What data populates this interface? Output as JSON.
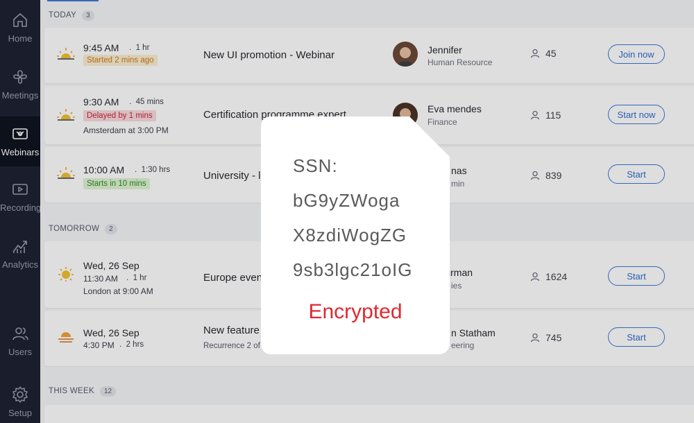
{
  "sidebar": {
    "items": [
      {
        "label": "Home",
        "icon": "home-icon",
        "active": false
      },
      {
        "label": "Meetings",
        "icon": "meetings-icon",
        "active": false
      },
      {
        "label": "Webinars",
        "icon": "webinars-icon",
        "active": true
      },
      {
        "label": "Recordings",
        "icon": "recordings-icon",
        "active": false
      },
      {
        "label": "Analytics",
        "icon": "analytics-icon",
        "active": false
      },
      {
        "label": "Users",
        "icon": "users-icon",
        "active": false
      },
      {
        "label": "Setup",
        "icon": "setup-icon",
        "active": false
      }
    ]
  },
  "sections": [
    {
      "title": "TODAY",
      "count": "3"
    },
    {
      "title": "TOMORROW",
      "count": "2"
    },
    {
      "title": "THIS WEEK",
      "count": "12"
    }
  ],
  "webinars": [
    {
      "time": "9:45 AM",
      "duration": "1 hr",
      "badge": "Started 2 mins ago",
      "badge_type": "orange",
      "title": "New UI promotion - Webinar",
      "host": "Jennifer",
      "dept": "Human Resource",
      "attendees": "45",
      "action": "Join now"
    },
    {
      "time": "9:30 AM",
      "duration": "45 mins",
      "badge": "Delayed by 1 mins",
      "badge_type": "red",
      "extra": "Amsterdam at 3:00 PM",
      "title": "Certification programme expert",
      "host": "Eva mendes",
      "dept": "Finance",
      "attendees": "115",
      "action": "Start now"
    },
    {
      "time": "10:00 AM",
      "duration": "1:30 hrs",
      "badge": "Starts in 10 mins",
      "badge_type": "green",
      "title": "University - l",
      "host": "nas",
      "dept": "min",
      "attendees": "839",
      "action": "Start"
    },
    {
      "date": "Wed, 26 Sep",
      "time": "11:30 AM",
      "duration": "1 hr",
      "extra": "London at 9:00 AM",
      "title": "Europe even",
      "host": "Thurman",
      "dept": "ies",
      "attendees": "1624",
      "action": "Start"
    },
    {
      "date": "Wed, 26 Sep",
      "time": "4:30 PM",
      "duration": "2 hrs",
      "title": "New feature",
      "subtitle": "Recurrence 2 of",
      "host": "n Statham",
      "dept": "eering",
      "attendees": "745",
      "action": "Start"
    }
  ],
  "popup": {
    "label": "SSN:",
    "lines": [
      "bG9yZWoga",
      "X8zdiWogZG",
      "9sb3lgc21oIG"
    ],
    "status": "Encrypted"
  },
  "colors": {
    "sidebar": "#1d2233",
    "accent": "#3b77d6",
    "encrypted": "#e0282e"
  }
}
